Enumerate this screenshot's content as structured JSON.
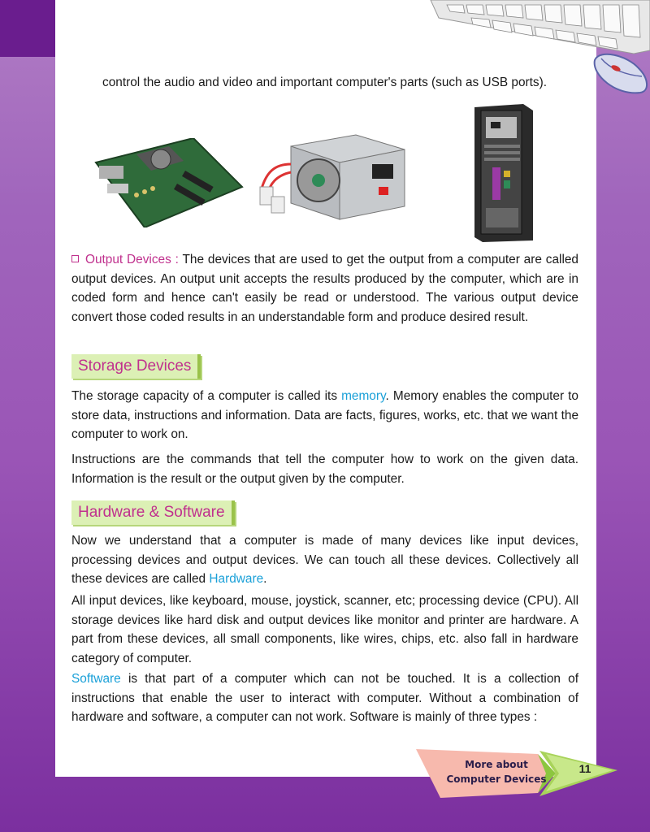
{
  "top_text": "control the audio and video and important computer's parts (such as USB ports).",
  "images": {
    "motherboard": "motherboard-photo",
    "power_supply": "power-supply-photo",
    "cpu_back": "cpu-cabinet-back-photo"
  },
  "output_devices": {
    "term": "Output Devices :",
    "text": " The devices that are used to get the output from a computer are called output devices. An output unit accepts the results produced by the computer, which are in coded form and hence can't easily be read or understood. The various output device convert those coded results in an understandable form and produce desired result."
  },
  "storage": {
    "heading": "Storage Devices",
    "p1_before": "The storage capacity of a computer is called its ",
    "p1_term": "memory",
    "p1_after": ". Memory enables the computer to store data, instructions and information. Data are facts, figures, works, etc. that we want the computer to work on.",
    "p2": "Instructions are the commands that tell the computer how to work on the given data. Information is the result or the output given by the computer."
  },
  "hardware_software": {
    "heading": "Hardware & Software",
    "p1_before": "Now we understand that a computer is made of many devices like input devices, processing devices and output devices. We can touch all these devices. Collectively all these devices are called ",
    "p1_term": "Hardware",
    "p1_after": ".",
    "p2": "All input devices, like keyboard, mouse, joystick, scanner, etc; processing device (CPU). All storage devices like hard disk and output devices like monitor and printer are hardware. A part from these devices, all small components, like wires, chips, etc. also fall in hardware category of computer.",
    "p3_term": "Software",
    "p3_after": " is that part of a computer which can not be touched. It is a collection of instructions that enable the user to interact with computer. Without a combination of hardware and software, a computer can not work. Software is mainly of three types :"
  },
  "footer": {
    "line1": "More about",
    "line2": "Computer Devices",
    "page_number": "11"
  },
  "colors": {
    "term_magenta": "#c0318e",
    "term_blue": "#1aa0d8",
    "heading_bg": "#dcf0b5",
    "corner_purple": "#6a1d8e"
  }
}
